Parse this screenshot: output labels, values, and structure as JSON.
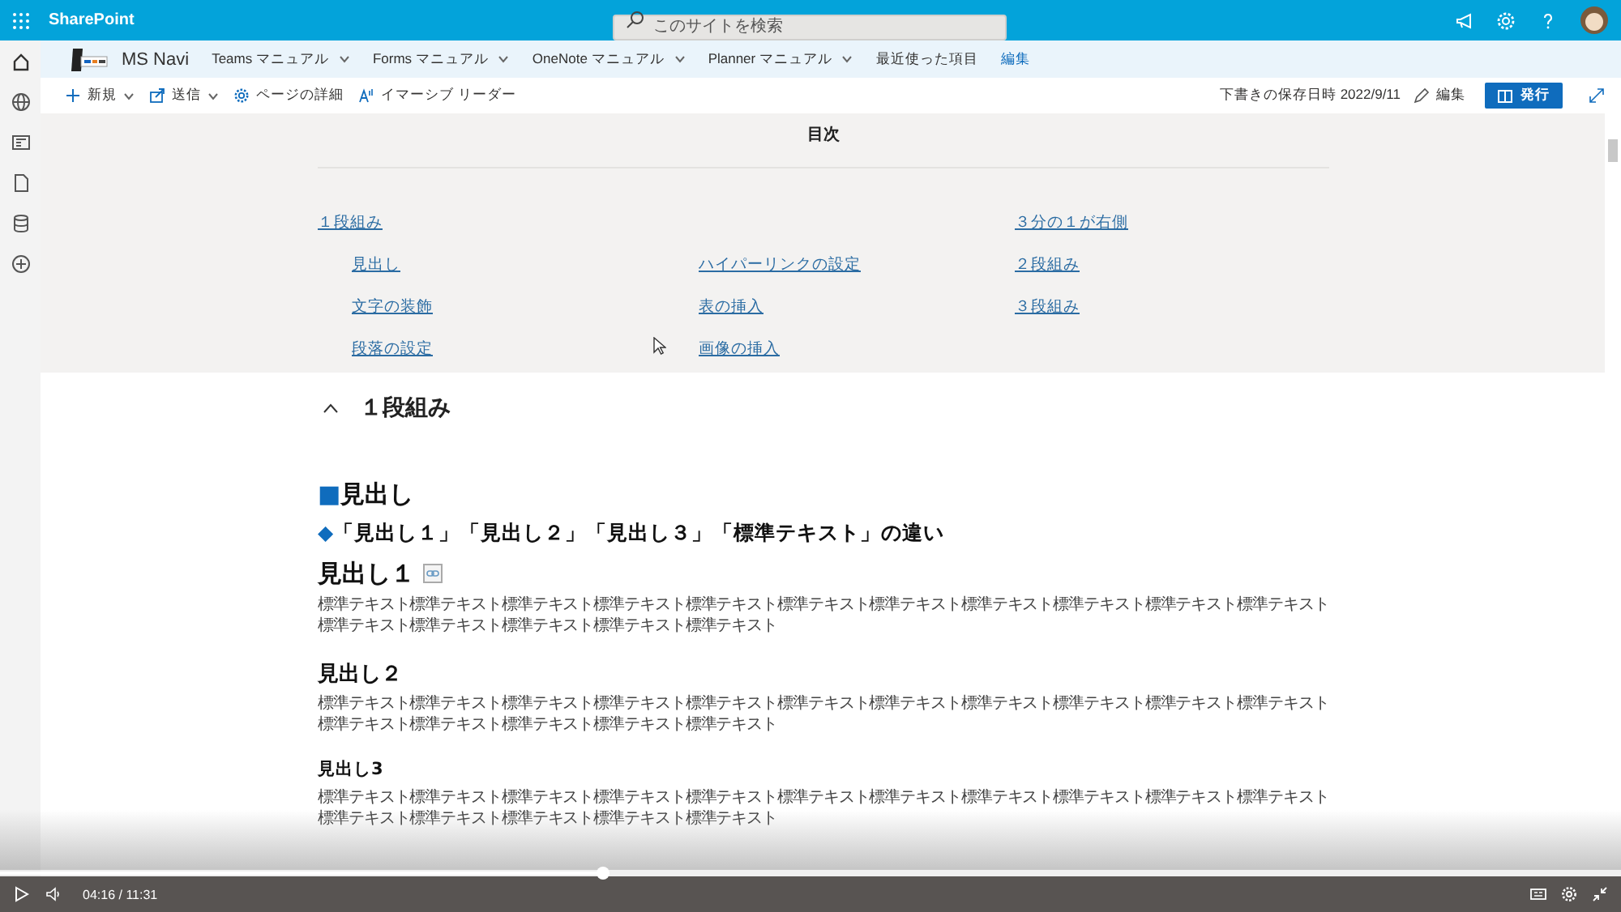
{
  "top_bar": {
    "app_name": "SharePoint",
    "search": {
      "placeholder": "このサイトを検索"
    }
  },
  "site_nav": {
    "site_name": "MS Navi",
    "items": [
      {
        "label": "Teams マニュアル",
        "dropdown": true
      },
      {
        "label": "Forms マニュアル",
        "dropdown": true
      },
      {
        "label": "OneNote マニュアル",
        "dropdown": true
      },
      {
        "label": "Planner マニュアル",
        "dropdown": true
      },
      {
        "label": "最近使った項目",
        "dropdown": false
      }
    ],
    "edit_link": "編集"
  },
  "command_bar": {
    "items": [
      {
        "label": "新規",
        "dropdown": true
      },
      {
        "label": "送信",
        "dropdown": true
      },
      {
        "label": "ページの詳細",
        "dropdown": false
      },
      {
        "label": "イマーシブ リーダー",
        "dropdown": false
      }
    ],
    "saved_status": "下書きの保存日時 2022/9/11",
    "edit_button": "編集",
    "publish_button": "発行"
  },
  "toc": {
    "title": "目次",
    "items": [
      {
        "label": "１段組み",
        "children": [
          {
            "label": "見出し"
          },
          {
            "label": "文字の装飾"
          },
          {
            "label": "段落の設定"
          },
          {
            "label": "ハイパーリンクの設定"
          },
          {
            "label": "表の挿入"
          },
          {
            "label": "画像の挿入"
          }
        ]
      },
      {
        "label": "３分の１が右側"
      },
      {
        "label": "２段組み"
      },
      {
        "label": "３段組み"
      }
    ]
  },
  "section": {
    "title": "１段組み",
    "expanded": true,
    "blocks": [
      {
        "kind": "marked-heading",
        "marker": "■",
        "text": "見出し"
      },
      {
        "kind": "marked-subheading",
        "marker": "◆",
        "text": "「見出し１」「見出し２」「見出し３」「標準テキスト」の違い"
      },
      {
        "kind": "heading1",
        "text": "見出し１",
        "anchor": true
      },
      {
        "kind": "paragraph",
        "text": "標準テキスト標準テキスト標準テキスト標準テキスト標準テキスト標準テキスト標準テキスト標準テキスト標準テキスト標準テキスト標準テキスト標準テキスト標準テキスト標準テキスト標準テキスト標準テキスト"
      },
      {
        "kind": "heading2",
        "text": "見出し２"
      },
      {
        "kind": "paragraph",
        "text": "標準テキスト標準テキスト標準テキスト標準テキスト標準テキスト標準テキスト標準テキスト標準テキスト標準テキスト標準テキスト標準テキスト標準テキスト標準テキスト標準テキスト標準テキスト標準テキスト"
      },
      {
        "kind": "heading3",
        "text": "見出し3"
      },
      {
        "kind": "paragraph",
        "text": "標準テキスト標準テキスト標準テキスト標準テキスト標準テキスト標準テキスト標準テキスト標準テキスト標準テキスト標準テキスト標準テキスト標準テキスト標準テキスト標準テキスト標準テキスト標準テキスト"
      }
    ]
  },
  "video_player": {
    "time": "04:16 / 11:31",
    "level": 0.372
  }
}
